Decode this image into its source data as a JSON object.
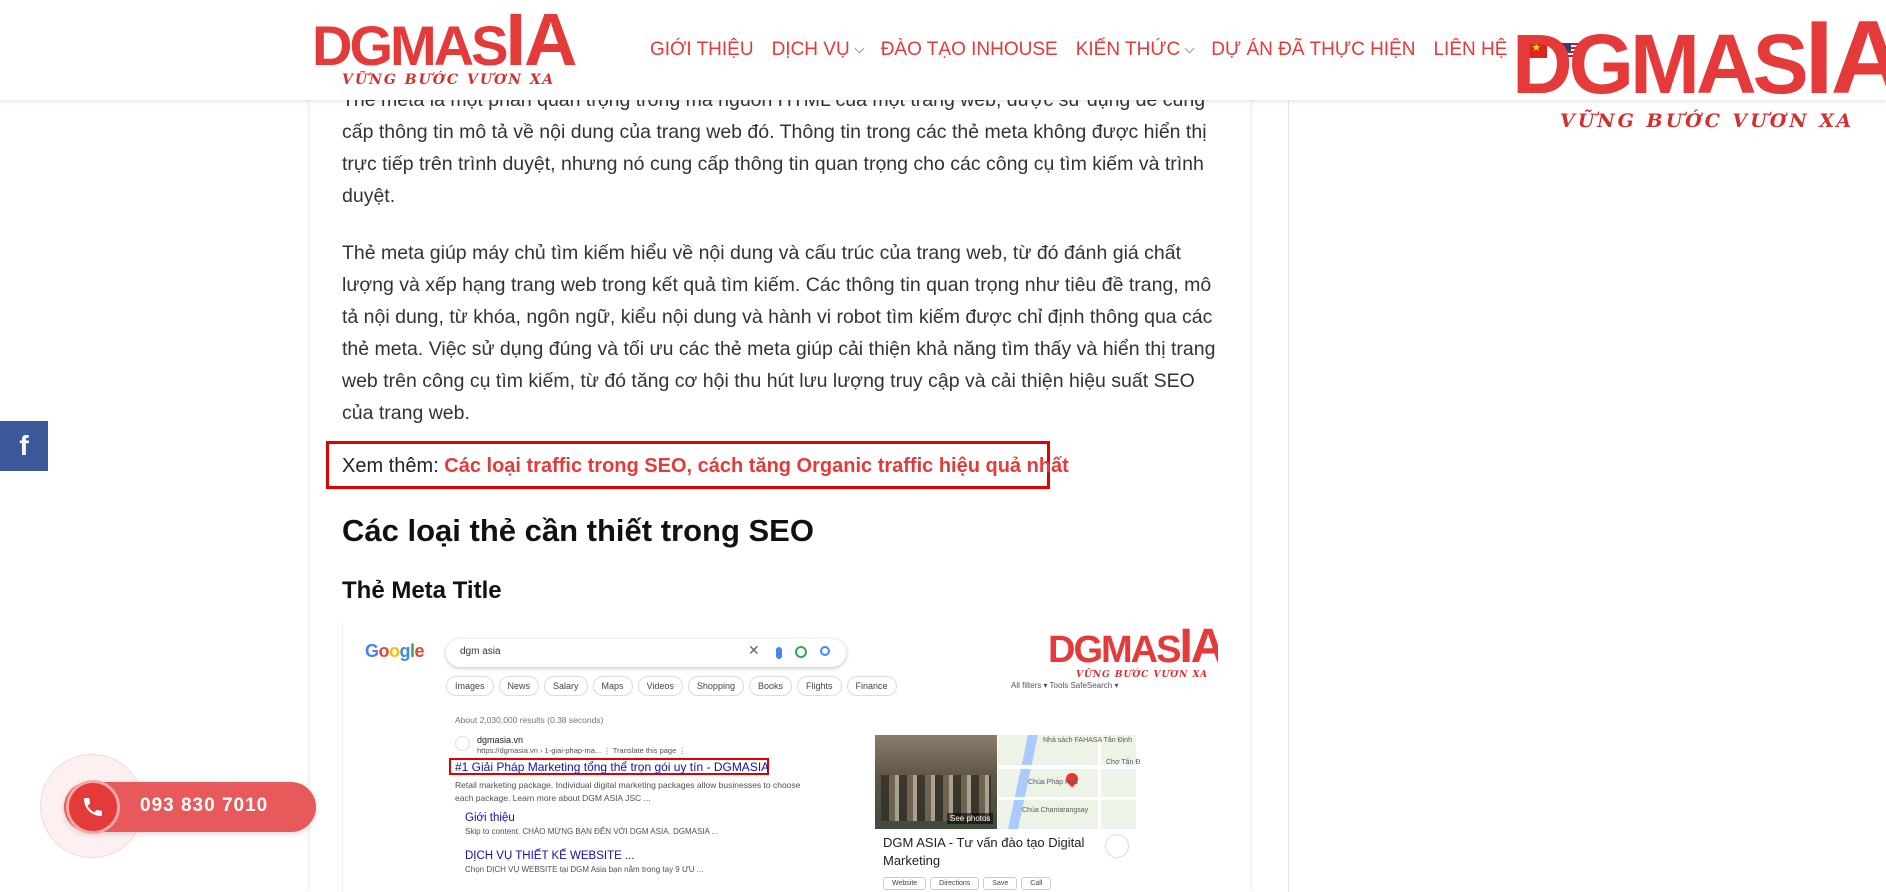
{
  "header": {
    "logo_text": "DGMASIA",
    "logo_tagline": "VỮNG BƯỚC VƯƠN XA",
    "nav": [
      {
        "label": "GIỚI THIỆU"
      },
      {
        "label": "DỊCH VỤ"
      },
      {
        "label": "ĐÀO TẠO INHOUSE"
      },
      {
        "label": "KIẾN THỨC"
      },
      {
        "label": "DỰ ÁN ĐÃ THỰC HIỆN"
      },
      {
        "label": "LIÊN HỆ"
      }
    ],
    "brand_color": "#e43a3a"
  },
  "watermark": {
    "text": "DGMASIA",
    "tagline": "VỮNG BƯỚC VƯƠN XA"
  },
  "article": {
    "para_top": "Thẻ meta là một phần quan trọng trong mã nguồn HTML của một trang web, được sử dụng để cung cấp thông tin mô tả về nội dung của trang web đó. Thông tin trong các thẻ meta không được hiển thị trực tiếp trên trình duyệt, nhưng nó cung cấp thông tin quan trọng cho các công cụ tìm kiếm và trình duyệt.",
    "para_mid": "Thẻ meta giúp máy chủ tìm kiếm hiểu về nội dung và cấu trúc của trang web, từ đó đánh giá chất lượng và xếp hạng trang web trong kết quả tìm kiếm. Các thông tin quan trọng như tiêu đề trang, mô tả nội dung, từ khóa, ngôn ngữ, kiểu nội dung và hành vi robot tìm kiếm được chỉ định thông qua các thẻ meta. Việc sử dụng đúng và tối ưu các thẻ meta giúp cải thiện khả năng tìm thấy và hiển thị trang web trên công cụ tìm kiếm, từ đó tăng cơ hội thu hút lưu lượng truy cập và cải thiện hiệu suất SEO của trang web.",
    "see_also_prefix": "Xem thêm: ",
    "see_also_link": "Các loại traffic trong SEO, cách tăng Organic traffic hiệu quả nhất",
    "h2": "Các loại thẻ cần thiết trong SEO",
    "h3": "Thẻ Meta Title"
  },
  "google_shot": {
    "logo": "Google",
    "query": "dgm asia",
    "tabs": [
      "Images",
      "News",
      "Salary",
      "Maps",
      "Videos",
      "Shopping",
      "Books",
      "Flights",
      "Finance"
    ],
    "tools": "All filters ▾     Tools              SafeSearch ▾",
    "count": "About 2,030,000 results (0.38 seconds)",
    "site": "dgmasia.vn",
    "url": "https://dgmasia.vn › 1-giai-phap-ma...  ⋮  Translate this page  ⋮",
    "title": "#1 Giải Pháp Marketing tổng thể trọn gói uy tín - DGMASIA",
    "snippet": "Retail marketing package. Individual digital marketing packages allow businesses to choose each package. Learn more about DGM ASIA JSC ...",
    "sub1_title": "Giới thiệu",
    "sub1_desc": "Skip to content. CHÀO MỪNG BẠN ĐẾN VỚI DGM ASIA. DGMASIA ...",
    "sub2_title": "DỊCH VỤ THIẾT KẾ WEBSITE ...",
    "sub2_desc": "Chọn DỊCH VỤ WEBSITE tại DGM Asia bạn nằm trong tay 9 ƯU ...",
    "see_photos": "See photos",
    "map_label_1": "Nhà sách FAHASA Tân Định",
    "map_label_2": "Chợ Tân Đ",
    "map_label_3": "Chùa Pháp Hoa",
    "map_label_4": "Chùa Chantarangsay",
    "kg_title": "DGM ASIA - Tư vấn đào tạo Digital Marketing",
    "kg_buttons": [
      "Website",
      "Directions",
      "Save",
      "Call"
    ],
    "watermark_text": "DGMASIA",
    "watermark_tagline": "VỮNG BƯỚC VƯƠN XA"
  },
  "widgets": {
    "facebook_label": "f",
    "phone": "093 830 7010"
  }
}
